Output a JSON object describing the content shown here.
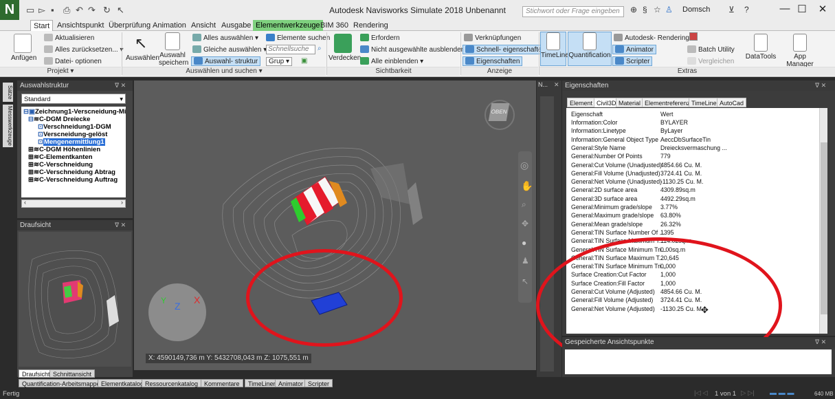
{
  "app": {
    "title": "Autodesk Navisworks Simulate 2018    Unbenannt",
    "logo": "N",
    "search_placeholder": "Stichwort oder Frage eingeben",
    "user": "Domsch",
    "minimize": "—",
    "maximize": "☐",
    "close": "✕"
  },
  "tabs": [
    "Start",
    "Ansichtspunkt",
    "Überprüfung",
    "Animation",
    "Ansicht",
    "Ausgabe",
    "Elementwerkzeuge",
    "BIM 360",
    "Rendering"
  ],
  "ribbon": {
    "projekt": {
      "anfuegen": "Anfügen",
      "aktualisieren": "Aktualisieren",
      "zurueck": "Alles zurücksetzen...",
      "datei": "Datei- optionen",
      "label": "Projekt"
    },
    "auswahl": {
      "auswaehlen": "Auswählen",
      "auswahl_speichern_1": "Auswahl",
      "auswahl_speichern_2": "speichern",
      "alles": "Alles auswählen",
      "gleiche": "Gleiche auswählen",
      "struktur": "Auswahl- struktur",
      "elemente": "Elemente suchen",
      "schnellsuche": "Schnellsuche",
      "grup": "Grup",
      "label": "Auswählen und suchen"
    },
    "sicht": {
      "verdecken": "Verdecken",
      "erfordern": "Erfordern",
      "nicht_ausgewaehlt": "Nicht ausgewählte ausblenden",
      "alle_einblenden": "Alle einblenden",
      "label": "Sichtbarkeit"
    },
    "anzeige": {
      "verknuepfungen": "Verknüpfungen",
      "schnell": "Schnell- eigenschaften",
      "eigenschaften": "Eigenschaften",
      "label": "Anzeige"
    },
    "extras": {
      "timeliner": "TimeLiner",
      "quantification": "Quantification",
      "autodesk_rendering": "Autodesk- Rendering",
      "animator": "Animator",
      "scripter": "Scripter",
      "batch": "Batch Utility",
      "vergleichen": "Vergleichen",
      "datatools": "DataTools",
      "appmanager": "App Manager",
      "label": "Extras"
    }
  },
  "left_sidebar": {
    "saetze": "Sätze",
    "mess": "Messwerkzeuge"
  },
  "tree": {
    "title": "Auswahlstruktur",
    "dropdown": "Standard",
    "items": [
      "Zeichnung1-Verscneidung-Mi",
      "C-DGM Dreiecke",
      "Verschneidung1-DGM",
      "Verscneidung-gelöst",
      "Mengenermittlung1",
      "C-DGM Höhenlinien",
      "C-Elementkanten",
      "C-Verschneidung",
      "C-Verschneidung Abtrag",
      "C-Verschneidung Auftrag"
    ]
  },
  "draufsicht": {
    "title": "Draufsicht",
    "tab1": "Draufsicht",
    "tab2": "Schnittansicht"
  },
  "viewport": {
    "coords": "X: 4590149,736 m  Y: 5432708,043 m  Z: 1075,551 m",
    "cube": "OBEN",
    "n_panel": "N..."
  },
  "properties": {
    "title": "Eigenschaften",
    "tabs": [
      "Element",
      "Civil3D",
      "Material",
      "Elementreferenz",
      "TimeLiner",
      "AutoCad"
    ],
    "header_key": "Eigenschaft",
    "header_val": "Wert",
    "rows": [
      [
        "Information:Color",
        "BYLAYER"
      ],
      [
        "Information:Linetype",
        "ByLayer"
      ],
      [
        "Information:General Object Type",
        "AeccDbSurfaceTin"
      ],
      [
        "General:Style Name",
        "Dreiecksvermaschung ..."
      ],
      [
        "General:Number Of Points",
        "779"
      ],
      [
        "General:Cut Volume (Unadjusted)",
        "4854.66 Cu. M."
      ],
      [
        "General:Fill Volume (Unadjusted)",
        "3724.41 Cu. M."
      ],
      [
        "General:Net Volume (Unadjusted)",
        "-1130.25 Cu. M."
      ],
      [
        "General:2D surface area",
        "4309.89sq.m"
      ],
      [
        "General:3D surface area",
        "4492.29sq.m"
      ],
      [
        "General:Minimum grade/slope",
        "3.77%"
      ],
      [
        "General:Maximum grade/slope",
        "63.80%"
      ],
      [
        "General:Mean grade/slope",
        "26.32%"
      ],
      [
        "General:TIN Surface Number Of ...",
        "1395"
      ],
      [
        "General:TIN Surface Maximum T...",
        "114.02sq.m"
      ],
      [
        "General:TIN Surface Minimum Tri...",
        "0.00sq.m"
      ],
      [
        "General:TIN Surface Maximum T...",
        "20,645"
      ],
      [
        "General:TIN Surface Minimum Tri...",
        "0,000"
      ],
      [
        "Surface Creation:Cut Factor",
        "1,000"
      ],
      [
        "Surface Creation:Fill Factor",
        "1,000"
      ],
      [
        "General:Cut Volume (Adjusted)",
        "4854.66 Cu. M."
      ],
      [
        "General:Fill Volume (Adjusted)",
        "3724.41 Cu. M."
      ],
      [
        "General:Net Volume (Adjusted)",
        "-1130.25 Cu. M."
      ]
    ],
    "saved_views": "Gespeicherte Ansichtspunkte"
  },
  "bottom_tabs": [
    "Quantification-Arbeitsmappe",
    "Elementkatalog",
    "Ressourcenkatalog",
    "Kommentare",
    "TimeLiner",
    "Animator",
    "Scripter"
  ],
  "status": {
    "left": "Fertig",
    "page": "1 von 1",
    "memory": "640 MB"
  }
}
